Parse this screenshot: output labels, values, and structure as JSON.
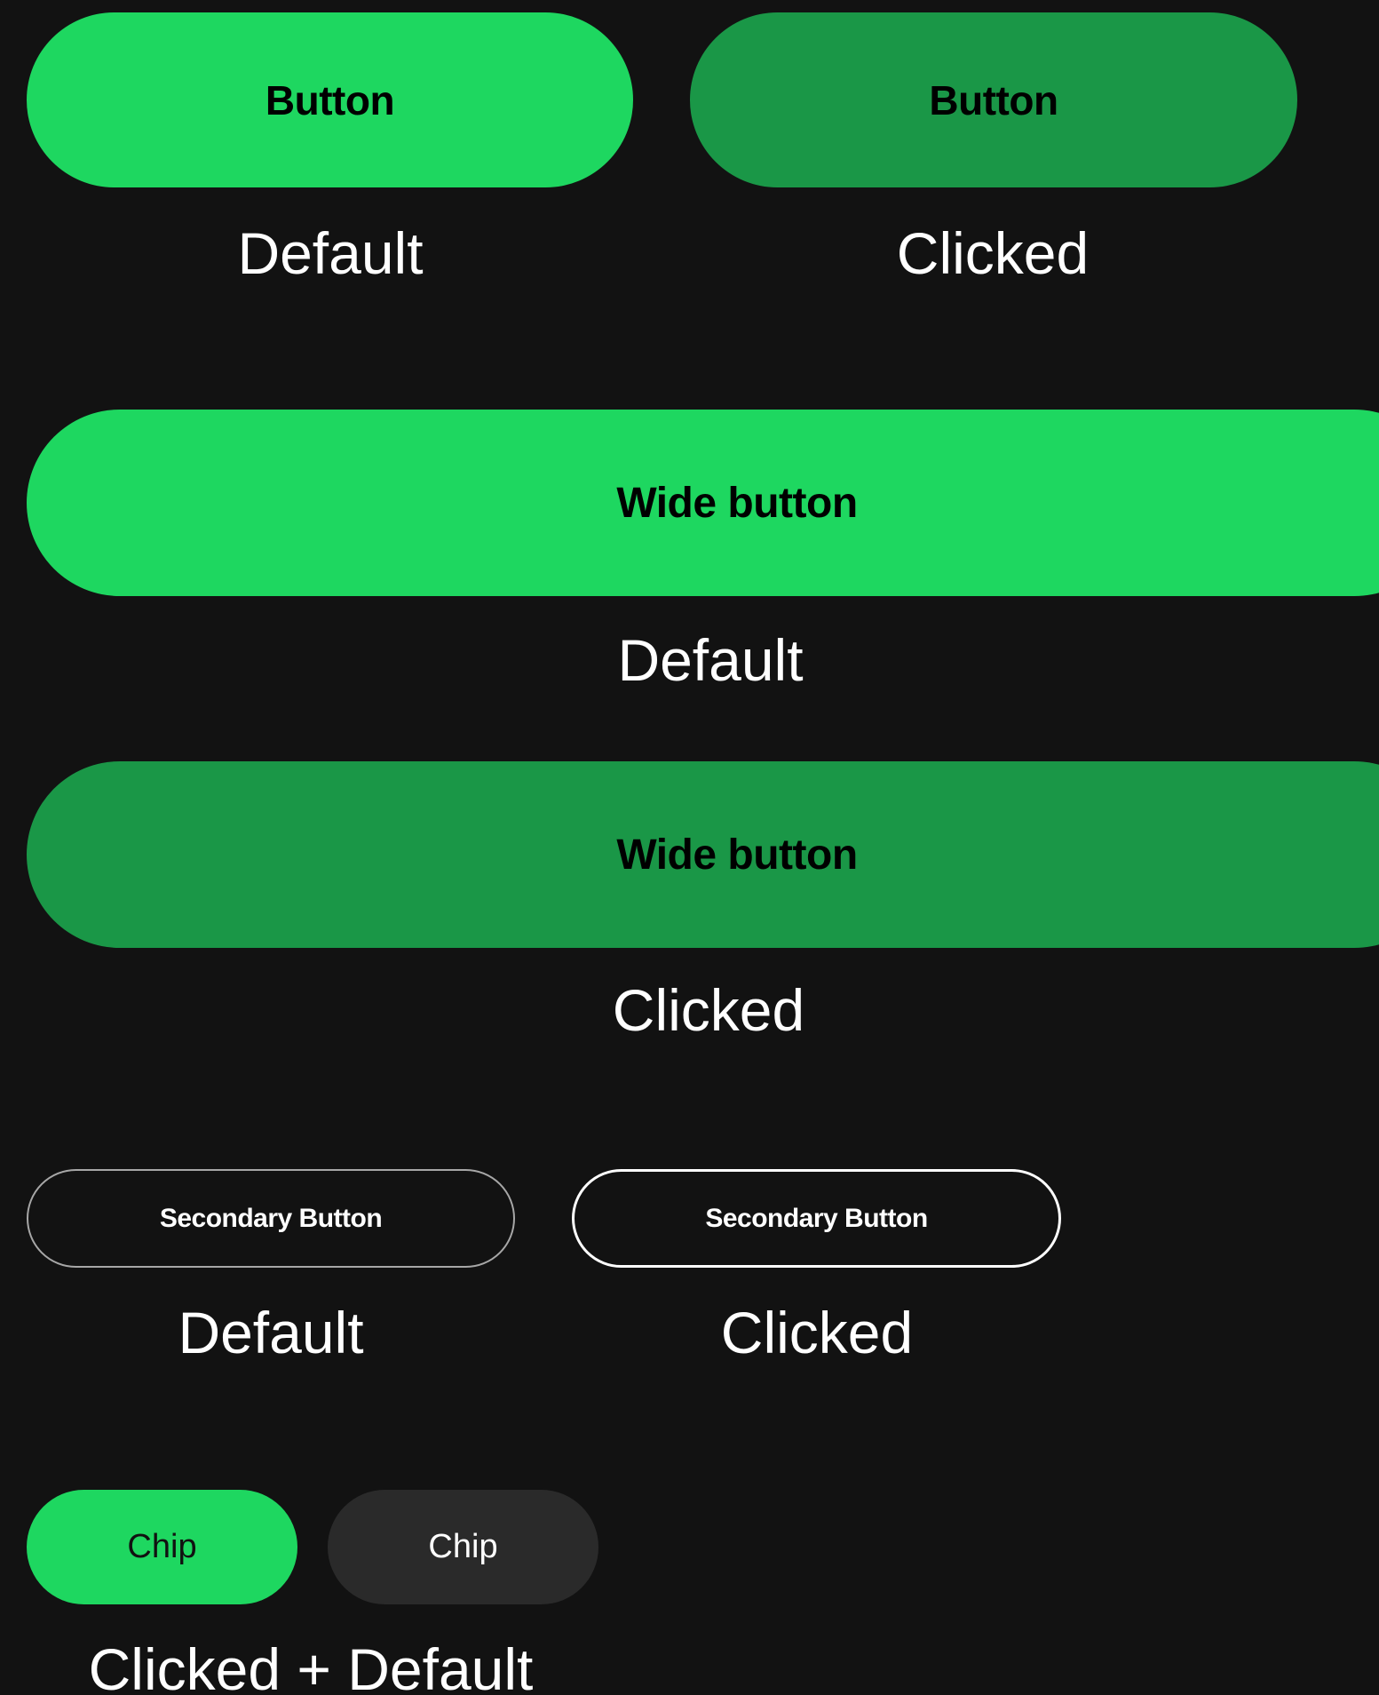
{
  "colors": {
    "background": "#121212",
    "primary_green": "#1ed760",
    "pressed_green": "#1a9747",
    "chip_idle": "#2a2a2a",
    "text_light": "#ffffff"
  },
  "buttons_row": {
    "default_label": "Button",
    "clicked_label": "Button",
    "default_caption": "Default",
    "clicked_caption": "Clicked"
  },
  "wide_default": {
    "label": "Wide button",
    "caption": "Default"
  },
  "wide_clicked": {
    "label": "Wide button",
    "caption": "Clicked"
  },
  "secondary_row": {
    "default_label": "Secondary Button",
    "clicked_label": "Secondary Button",
    "default_caption": "Default",
    "clicked_caption": "Clicked"
  },
  "chips": {
    "active_label": "Chip",
    "idle_label": "Chip",
    "caption": "Clicked + Default"
  }
}
